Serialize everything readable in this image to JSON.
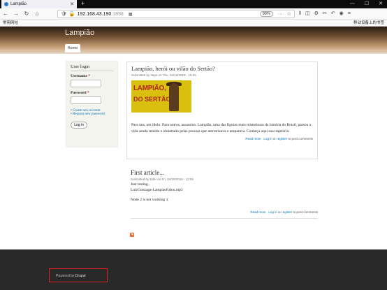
{
  "browser": {
    "tab_title": "Lampião",
    "new_tab": "+",
    "url_host": "192.168.43.190",
    "url_port": ":1898",
    "zoom": "90%",
    "bookmarks_left": "常用网址",
    "bookmarks_right": "移动设备上的书签"
  },
  "site": {
    "name": "Lampião",
    "nav_home": "Home"
  },
  "login_block": {
    "title": "User login",
    "username_label": "Username",
    "password_label": "Password",
    "required_mark": "*",
    "create_account": "Create new account",
    "request_password": "Request new password",
    "login_button": "Log in"
  },
  "articles": [
    {
      "title": "Lampião, herói ou vilão do Sertão?",
      "submitted": "Submitted by tiago on Thu, 04/19/2018 - 18:25",
      "poster_line1": "LAMPIÃO,",
      "poster_line2": "DO SERTÃO",
      "body": "Para uns, um ídolo. Para outros, assassino. Lampião, uma das figuras mais misteriosas da história do Brasil, passou a vida sendo temido e idolatrado pelas pessoas que aterrorizava e amparava. Conheça aqui sua trajetória.",
      "read_more": "Read more",
      "log_in": "Log in",
      "or": "or",
      "register": "register",
      "post_comments": "to post comments"
    },
    {
      "title": "First article...",
      "submitted": "Submitted by Eder on Fri, 04/20/2018 - 13:55",
      "line1": "Just testing..",
      "line2": "LuizGonzaga-LampiaoFalou.mp3",
      "line3": "Node 2 is not working :(",
      "read_more": "Read more",
      "log_in": "Log in",
      "or": "or",
      "register": "register",
      "post_comments": "to post comments"
    }
  ],
  "footer": {
    "powered_by": "Powered by",
    "drupal": "Drupal"
  }
}
